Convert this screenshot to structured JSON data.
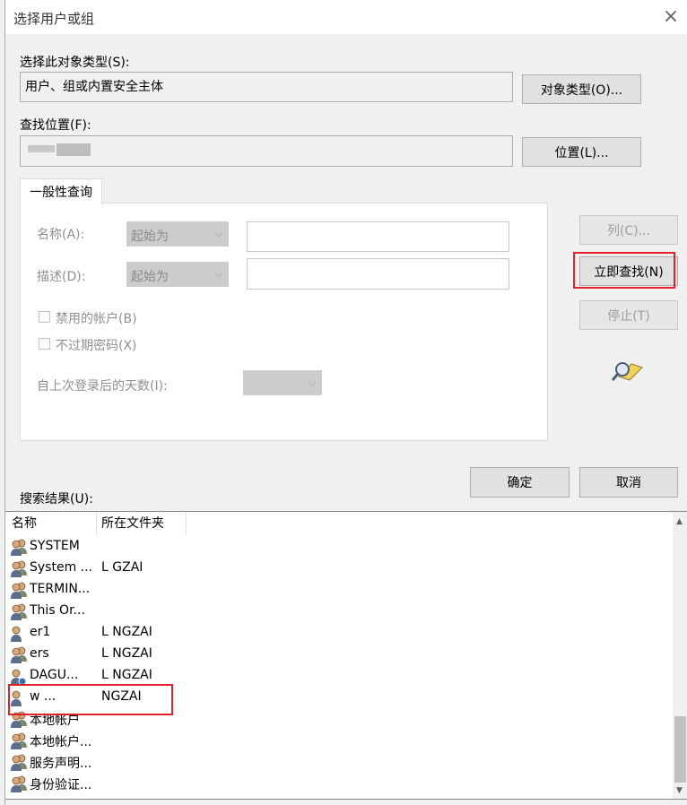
{
  "window": {
    "title": "选择用户或组",
    "close_label": "×"
  },
  "object_type": {
    "label": "选择此对象类型(S):",
    "value": "用户、组或内置安全主体",
    "button": "对象类型(O)..."
  },
  "location": {
    "label": "查找位置(F):",
    "value": "",
    "button": "位置(L)..."
  },
  "query_tab": {
    "label": "一般性查询"
  },
  "query": {
    "name_label": "名称(A):",
    "name_mode": "起始为",
    "desc_label": "描述(D):",
    "desc_mode": "起始为",
    "disabled_accounts": "禁用的帐户(B)",
    "non_expiring": "不过期密码(X)",
    "days_label": "自上次登录后的天数(I):"
  },
  "buttons": {
    "columns": "列(C)...",
    "find_now": "立即查找(N)",
    "stop": "停止(T)",
    "ok": "确定",
    "cancel": "取消"
  },
  "results": {
    "label": "搜索结果(U):",
    "columns": [
      "名称",
      "所在文件夹"
    ],
    "rows": [
      {
        "name": "SYSTEM",
        "folder": "",
        "icon": "group-icon"
      },
      {
        "name": "System ...",
        "folder": "L   GZAI",
        "icon": "group-icon"
      },
      {
        "name": "TERMIN...",
        "folder": "",
        "icon": "group-icon"
      },
      {
        "name": "This Or...",
        "folder": "",
        "icon": "group-icon"
      },
      {
        "name": "  er1",
        "folder": "L   NGZAI",
        "icon": "user-icon"
      },
      {
        "name": "  ers",
        "folder": "L   NGZAI",
        "icon": "group-icon"
      },
      {
        "name": "  DAGU...",
        "folder": "L   NGZAI",
        "icon": "admin-user-icon"
      },
      {
        "name": "w      ...",
        "folder": "   NGZAI",
        "icon": "user-icon"
      },
      {
        "name": "本地帐户",
        "folder": "",
        "icon": "group-icon"
      },
      {
        "name": "本地帐户...",
        "folder": "",
        "icon": "group-icon"
      },
      {
        "name": "服务声明...",
        "folder": "",
        "icon": "group-icon"
      },
      {
        "name": "身份验证...",
        "folder": "",
        "icon": "group-icon"
      }
    ]
  },
  "colors": {
    "highlight": "#e0202a",
    "button_bg": "#e1e1e1",
    "dialog_bg": "#f0f0f0"
  }
}
